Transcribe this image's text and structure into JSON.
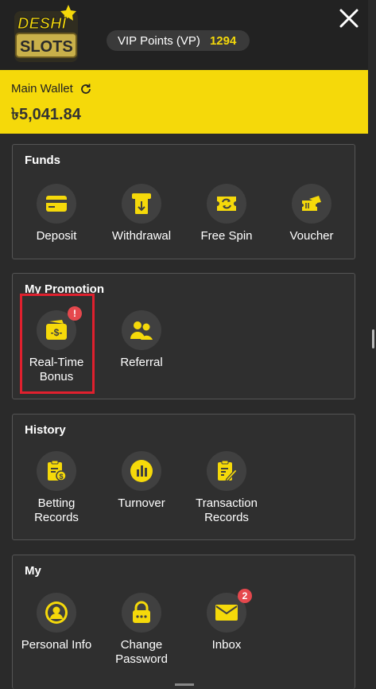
{
  "header": {
    "logo_text_top": "DESHI",
    "logo_text_bottom": "SLOTS",
    "vip_label": "VIP Points (VP)",
    "vip_value": "1294"
  },
  "wallet": {
    "label": "Main Wallet",
    "amount": "৳5,041.84"
  },
  "sections": {
    "funds": {
      "title": "Funds",
      "items": [
        {
          "label": "Deposit",
          "icon": "deposit-card-icon"
        },
        {
          "label": "Withdrawal",
          "icon": "withdrawal-atm-icon"
        },
        {
          "label": "Free Spin",
          "icon": "free-spin-ticket-icon"
        },
        {
          "label": "Voucher",
          "icon": "voucher-icon"
        }
      ]
    },
    "promotion": {
      "title": "My Promotion",
      "items": [
        {
          "label": "Real-Time Bonus",
          "icon": "bonus-wallet-icon",
          "badge": "!"
        },
        {
          "label": "Referral",
          "icon": "referral-people-icon"
        }
      ]
    },
    "history": {
      "title": "History",
      "items": [
        {
          "label": "Betting Records",
          "icon": "betting-records-icon"
        },
        {
          "label": "Turnover",
          "icon": "turnover-chart-icon"
        },
        {
          "label": "Transaction Records",
          "icon": "transaction-records-icon"
        }
      ]
    },
    "my": {
      "title": "My",
      "items": [
        {
          "label": "Personal Info",
          "icon": "person-icon"
        },
        {
          "label": "Change Password",
          "icon": "lock-password-icon"
        },
        {
          "label": "Inbox",
          "icon": "mail-icon",
          "badge": "2"
        }
      ]
    }
  },
  "colors": {
    "accent": "#f5d90a",
    "background": "#2a2a2a",
    "card": "#2f2f2f",
    "badge": "#e5484d",
    "highlight": "#e0202e"
  }
}
